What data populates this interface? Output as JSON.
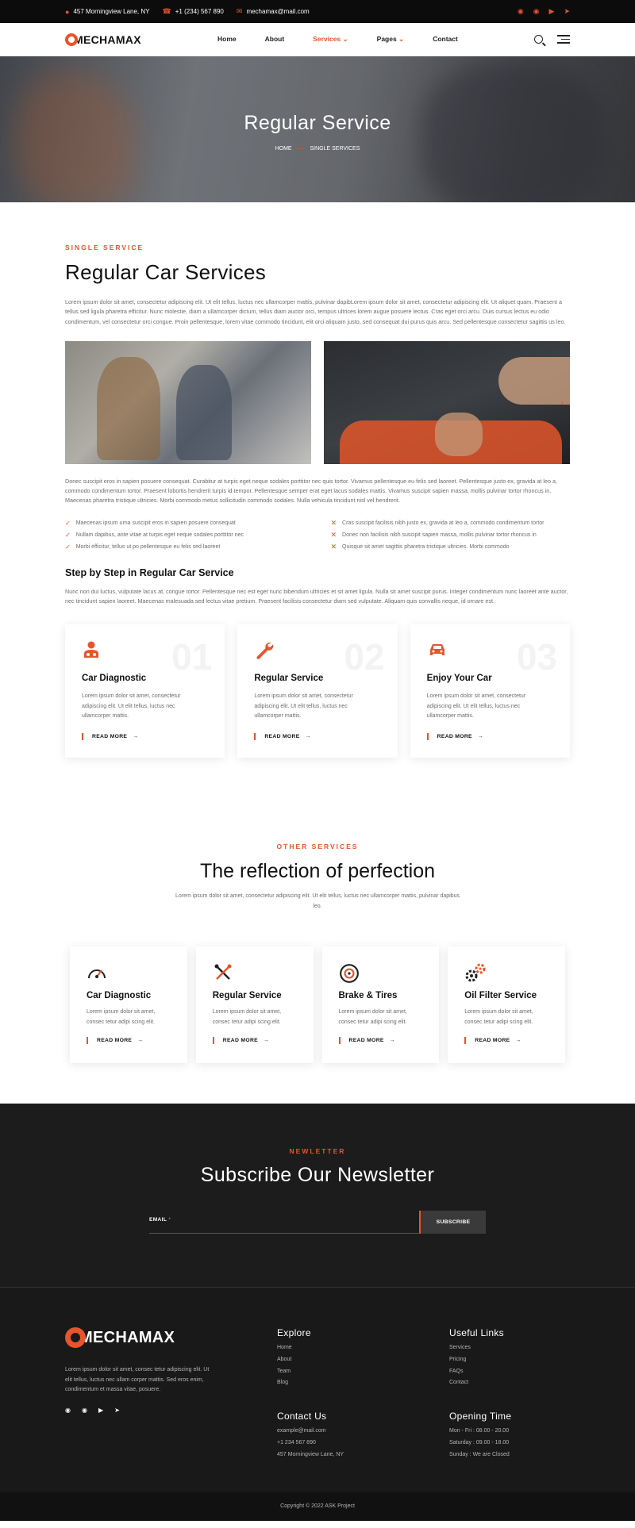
{
  "topbar": {
    "address": "457 Morningview Lane, NY",
    "phone": "+1 (234) 567 890",
    "email": "mechamax@mail.com",
    "socials": [
      "facebook-icon",
      "twitter-icon",
      "youtube-icon",
      "telegram-icon"
    ]
  },
  "nav": {
    "logo": "MECHAMAX",
    "menu": [
      "Home",
      "About",
      "Services",
      "Pages",
      "Contact"
    ],
    "active": "Services"
  },
  "hero": {
    "title": "Regular Service",
    "crumb_home": "HOME",
    "crumb_current": "SINGLE SERVICES"
  },
  "single": {
    "eyebrow": "SINGLE SERVICE",
    "title": "Regular Car Services",
    "intro": "Lorem ipsum dolor sit amet, consectetur adipiscing elit. Ut elit tellus, luctus nec ullamcorper mattis, pulvinar dapibLorem ipsum dolor sit amet, consectetur adipiscing elit. Ut aliquet quam. Praesent a tellus sed ligula pharetra efficitur. Nunc molestie, diam a ullamcorper dictum, tellus diam auctor orci, tempus ultrices lorem augue posuere lectus. Cras eget orci arcu. Duis cursus lectus eu odio condimentum, vel consectetur orci congue. Proin pellentesque, lorem vitae commodo tincidunt, elit orci aliquam justo, sed consequat dui purus quis arcu. Sed pellentesque consectetur sagittis us leo.",
    "body": "Donec suscipit eros in sapien posuere consequat. Curabitur at turpis eget neque sodales porttitor nec quis tortor. Vivamus pellentesque eu felis sed laoreet. Pellentesque justo ex, gravida at leo a, commodo condimentum tortor. Praesent lobortis hendrerit turpis id tempor. Pellentesque semper erat eget lacus sodales mattis. Vivamus suscipit sapien massa, mollis pulvinar tortor rhoncus in. Maecenas pharetra tristique ultricies. Morbi commodo metus sollicitudin commodo sodales. Nulla vehicula tincidunt nisl vel hendrerit.",
    "checks_left": [
      "Maecenas ipsum urna suscipit eros in sapien posuere consequat",
      "Nullam dapibus, ante vitae at turpis eget neque sodales porttitor nec",
      "Morbi efficitur, tellus ut po pellentesque eu felis sed laoreet"
    ],
    "checks_right": [
      "Cras suscipit facilisis nibh justo ex, gravida at leo a, commodo condimentum tortor",
      "Donec non facilisis nibh suscipit sapien massa, mollis pulvinar tortor rhoncus in",
      "Quisque sit amet sagittis pharetra tristique ultricies. Morbi commodo"
    ],
    "step_title": "Step by Step in Regular Car Service",
    "step_text": "Nunc non dui luctus, vulputate lacus at, congue tortor. Pellentesque nec est eget nunc bibendum ultricies et sit amet ligula. Nulla sit amet suscipit purus. Integer condimentum nunc laoreet ante auctor, nec tincidunt sapien laoreet. Maecenas malesuada sed lectus vitae pretium. Praesent facilisis consectetur diam sed vulputate. Aliquam quis convallis neque, id ornare est.",
    "cards": [
      {
        "num": "01",
        "icon": "mechanic-icon",
        "title": "Car Diagnostic",
        "text": "Lorem ipsum dolor sit amet, consectetur adipiscing elit. Ut elit tellus, luctus nec ullamcorper mattis.",
        "link": "READ MORE"
      },
      {
        "num": "02",
        "icon": "wrench-icon",
        "title": "Regular Service",
        "text": "Lorem ipsum dolor sit amet, consectetur adipiscing elit. Ut elit tellus, luctus nec ullamcorper mattis.",
        "link": "READ MORE"
      },
      {
        "num": "03",
        "icon": "car-icon",
        "title": "Enjoy Your Car",
        "text": "Lorem ipsum dolor sit amet, consectetur adipiscing elit. Ut elit tellus, luctus nec ullamcorper mattis.",
        "link": "READ MORE"
      }
    ]
  },
  "others": {
    "eyebrow": "OTHER SERVICES",
    "title": "The reflection of perfection",
    "sub": "Lorem ipsum dolor sit amet, consectetur adipiscing elit. Ut elit tellus, luctus nec ullamcorper mattis, pulvinar dapibus leo.",
    "cards": [
      {
        "icon": "gauge-icon",
        "title": "Car Diagnostic",
        "text": "Lorem ipsum dolor sit amet, consec tetur adipi scing elit.",
        "link": "READ MORE"
      },
      {
        "icon": "tools-icon",
        "title": "Regular Service",
        "text": "Lorem ipsum dolor sit amet, consec tetur adipi scing elit.",
        "link": "READ MORE"
      },
      {
        "icon": "brake-disc-icon",
        "title": "Brake & Tires",
        "text": "Lorem ipsum dolor sit amet, consec tetur adipi scing elit.",
        "link": "READ MORE"
      },
      {
        "icon": "gears-icon",
        "title": "Oil Filter Service",
        "text": "Lorem ipsum dolor sit amet, consec tetur adipi scing elit.",
        "link": "READ MORE"
      }
    ]
  },
  "newsletter": {
    "eyebrow": "NEWLETTER",
    "title": "Subscribe Our Newsletter",
    "email_label": "EMAIL",
    "required_mark": "*",
    "button": "SUBSCRIBE"
  },
  "footer": {
    "logo": "MECHAMAX",
    "about": "Lorem ipsum dolor sit amet, consec tetur adipiscing elit. Ut elit tellus, luctus nec ullam corper mattis. Sed eros enim, condimentum et massa vitae, posuere.",
    "explore_title": "Explore",
    "explore": [
      "Home",
      "About",
      "Team",
      "Blog"
    ],
    "useful_title": "Useful Links",
    "useful": [
      "Services",
      "Pricing",
      "FAQs",
      "Contact"
    ],
    "contact_title": "Contact Us",
    "contact": [
      "example@mail.com",
      "+1 234 567 890",
      "457 Morningview Lane, NY"
    ],
    "hours_title": "Opening Time",
    "hours": [
      "Mon - Fri : 08.00 - 20.00",
      "Saturday : 09.00 - 18.00",
      "Sunday : We are Closed"
    ],
    "copyright": "Copyright © 2022 ASK Project"
  },
  "colors": {
    "accent": "#e8542b",
    "dark": "#1c1c1c",
    "topbar": "#0c0c0c"
  }
}
